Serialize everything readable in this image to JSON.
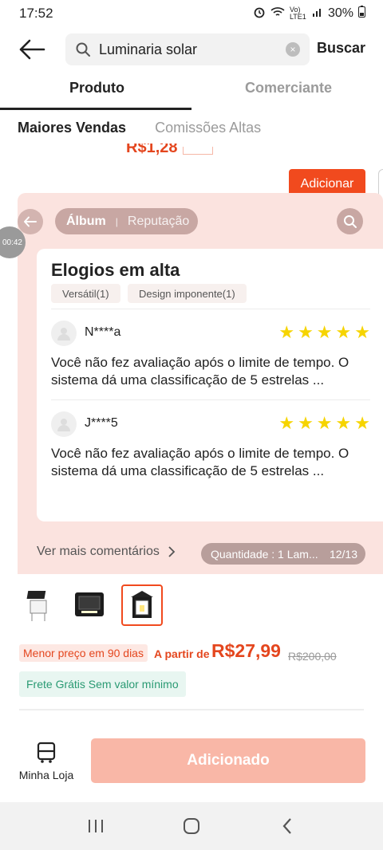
{
  "status": {
    "time": "17:52",
    "battery": "30%",
    "network": "Vo) LTE1"
  },
  "search": {
    "query": "Luminaria solar",
    "button": "Buscar"
  },
  "tabs": [
    {
      "label": "Produto",
      "active": true
    },
    {
      "label": "Comerciante",
      "active": false
    }
  ],
  "subtabs": [
    {
      "label": "Maiores Vendas"
    },
    {
      "label": "Comissões Altas"
    }
  ],
  "behind": {
    "price_fragment": "R$1,28",
    "add_button": "Adicionar"
  },
  "overlay": {
    "tab_album": "Álbum",
    "tab_reputacao": "Reputação",
    "timer": "00:42",
    "card_title": "Elogios em alta",
    "tags": [
      "Versátil(1)",
      "Design imponente(1)"
    ],
    "reviews": [
      {
        "name": "N****a",
        "rating": 5,
        "text": "Você não fez avaliação após o limite de tempo. O sistema dá uma classificação de 5 estrelas ..."
      },
      {
        "name": "J****5",
        "rating": 5,
        "text": "Você não fez avaliação após o limite de tempo. O sistema dá uma classificação de 5 estrelas ..."
      }
    ],
    "see_more": "Ver mais comentários",
    "quantity": "Quantidade : 1 Lam...",
    "page": "12/13"
  },
  "product": {
    "lowest_badge": "Menor preço em 90 dias",
    "from_label": "A partir de",
    "price": "R$27,99",
    "old_price": "R$200,00",
    "shipping": "Frete Grátis Sem valor mínimo"
  },
  "bottom": {
    "store_label": "Minha Loja",
    "added_button": "Adicionado"
  },
  "colors": {
    "accent": "#f14a1e",
    "price": "#e4461e",
    "star": "#f6d400",
    "overlay_bg": "#fbe3df"
  }
}
